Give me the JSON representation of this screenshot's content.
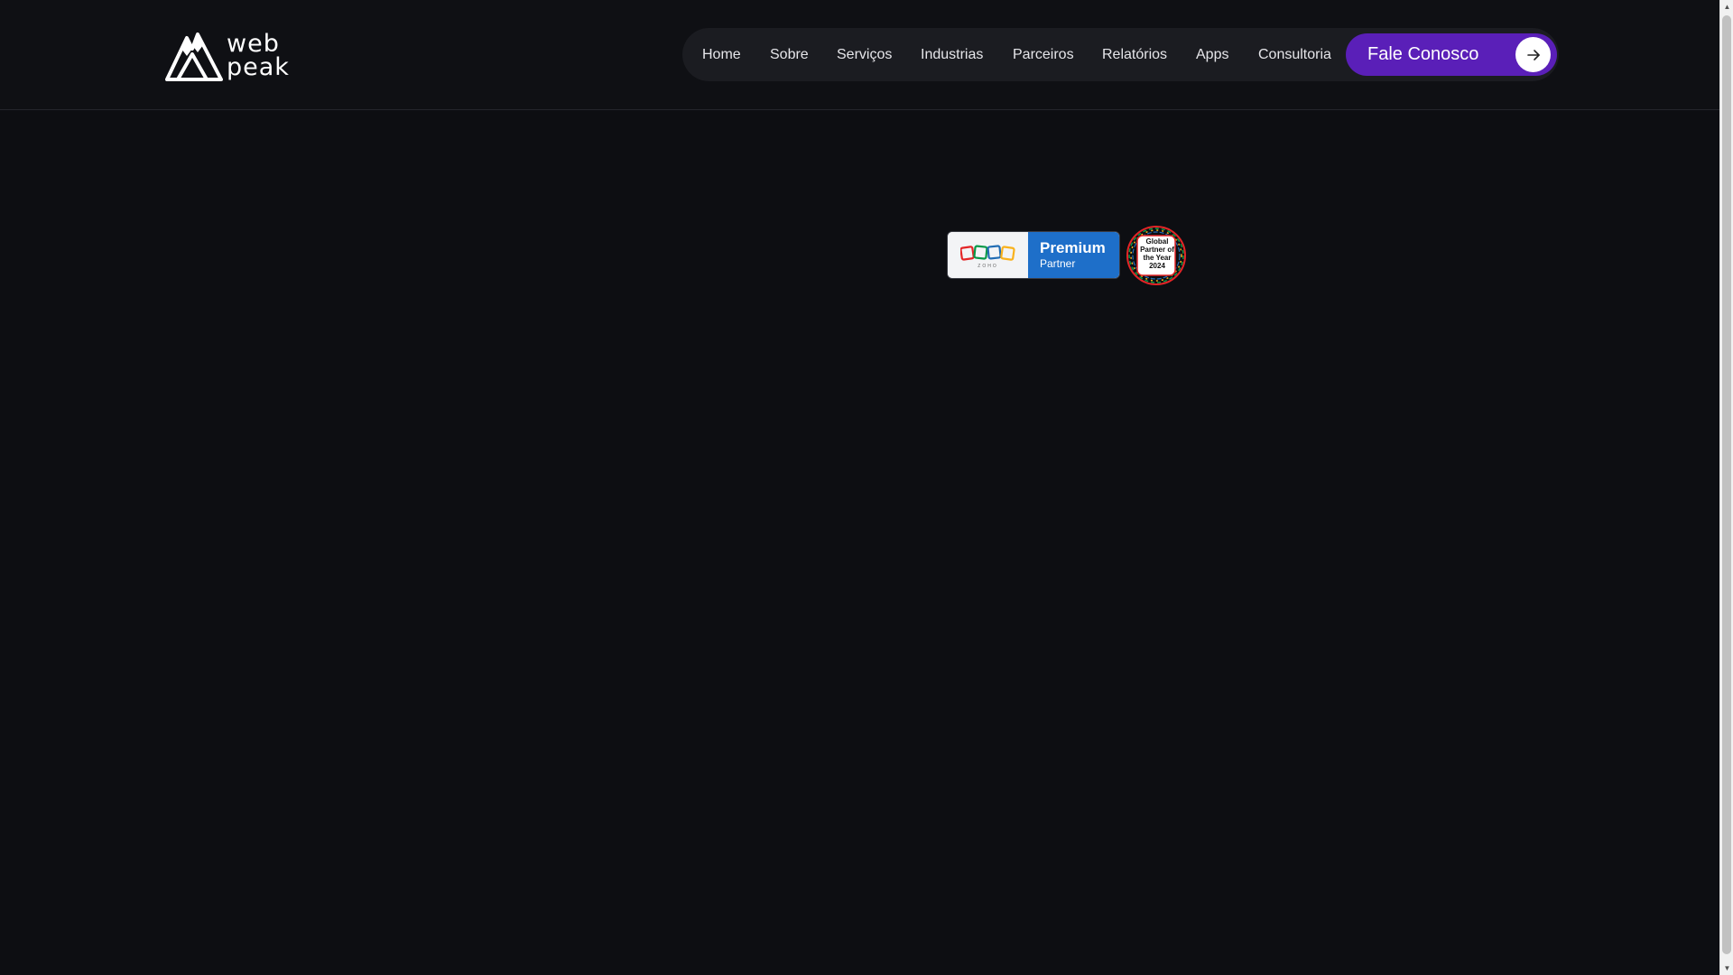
{
  "header": {
    "logo": {
      "line1": "web",
      "line2": "peak",
      "icon": "mountain-logo-icon"
    },
    "nav": {
      "items": [
        {
          "label": "Home"
        },
        {
          "label": "Sobre"
        },
        {
          "label": "Serviços"
        },
        {
          "label": "Industrias"
        },
        {
          "label": "Parceiros"
        },
        {
          "label": "Relatórios"
        },
        {
          "label": "Apps"
        },
        {
          "label": "Consultoria"
        }
      ],
      "cta_label": "Fale Conosco",
      "cta_icon": "arrow-right-icon"
    }
  },
  "badges": {
    "zoho": {
      "brand": "ZOHO",
      "title": "Premium",
      "subtitle": "Partner"
    },
    "global_partner": {
      "text": "Global Partner of the Year 2024"
    }
  },
  "colors": {
    "background": "#0d0e12",
    "cta": "#5a1fb8",
    "premium_blue": "#1e6fc9"
  }
}
